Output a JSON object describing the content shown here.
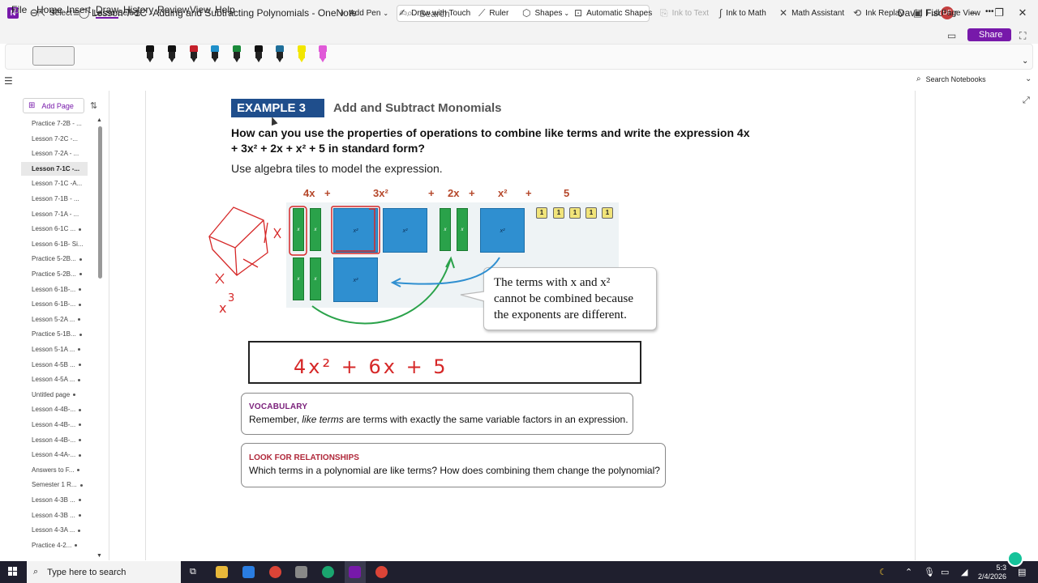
{
  "window": {
    "title": "Lesson 7-1C -Adding and Subtracting Polynomials - OneNote",
    "search_placeholder": "Search",
    "user_name": "David Fischer",
    "user_initials": "DF"
  },
  "menu": {
    "items": [
      "File",
      "Home",
      "Insert",
      "Draw",
      "History",
      "Review",
      "View",
      "Help"
    ],
    "active": "Draw",
    "share_label": "Share"
  },
  "ribbon": {
    "select": "Select",
    "lasso_select": "Lasso Select",
    "add_pen": "Add Pen",
    "draw_with_touch": "Draw with Touch",
    "ruler": "Ruler",
    "shapes": "Shapes",
    "automatic_shapes": "Automatic Shapes",
    "ink_to_text": "Ink to Text",
    "ink_to_shape": "Ink to Math",
    "math_assistant": "Math Assistant",
    "ink_replay": "Ink Replay",
    "full_page_view": "Full Page View",
    "more": "•••",
    "pen_colors": [
      "#111111",
      "#111111",
      "#c4202a",
      "#1f8fc9",
      "#1a8a3a",
      "#111111",
      "#1f6f9a",
      "#f2e600",
      "#e05ad8"
    ]
  },
  "search_notebooks": "Search Notebooks",
  "sidebar": {
    "add_page": "Add Page",
    "pages": [
      {
        "label": "Practice 7-2B - ...",
        "dot": false
      },
      {
        "label": "Lesson 7-2C -...",
        "dot": false
      },
      {
        "label": "Lesson 7-2A - ...",
        "dot": false
      },
      {
        "label": "Lesson 7-1C -...",
        "dot": false,
        "selected": true
      },
      {
        "label": "Lesson 7-1C -A...",
        "dot": false
      },
      {
        "label": "Lesson 7-1B - ...",
        "dot": false
      },
      {
        "label": "Lesson 7-1A - ...",
        "dot": false
      },
      {
        "label": "Lesson 6-1C ...",
        "dot": true
      },
      {
        "label": "Lesson 6-1B- Si...",
        "dot": false
      },
      {
        "label": "Practice 5-2B...",
        "dot": true
      },
      {
        "label": "Practice 5-2B...",
        "dot": true
      },
      {
        "label": "Lesson 6-1B-...",
        "dot": true
      },
      {
        "label": "Lesson 6-1B-...",
        "dot": true
      },
      {
        "label": "Lesson 5-2A ...",
        "dot": true
      },
      {
        "label": "Practice 5-1B...",
        "dot": true
      },
      {
        "label": "Lesson 5-1A ...",
        "dot": true
      },
      {
        "label": "Lesson 4-5B ...",
        "dot": true
      },
      {
        "label": "Lesson 4-5A ...",
        "dot": true
      },
      {
        "label": "Untitled page",
        "dot": true
      },
      {
        "label": "Lesson 4-4B-...",
        "dot": true
      },
      {
        "label": "Lesson 4-4B-...",
        "dot": true
      },
      {
        "label": "Lesson 4-4B-...",
        "dot": true
      },
      {
        "label": "Lesson 4-4A-...",
        "dot": true
      },
      {
        "label": "Answers to F...",
        "dot": true
      },
      {
        "label": "Semester 1 R...",
        "dot": true
      },
      {
        "label": "Lesson 4-3B ...",
        "dot": true
      },
      {
        "label": "Lesson 4-3B ...",
        "dot": true
      },
      {
        "label": "Lesson 4-3A ...",
        "dot": true
      },
      {
        "label": "Practice 4-2...",
        "dot": true
      }
    ]
  },
  "content": {
    "example_label": "EXAMPLE 3",
    "example_title": "Add and Subtract Monomials",
    "question_line1": "How can you use the properties of operations to combine like terms and write the expression 4x",
    "question_line2": "+ 3x² + 2x + x² + 5 in standard form?",
    "instruction": "Use algebra tiles to model the expression.",
    "tile_headers": [
      "4x",
      "+",
      "3x²",
      "+",
      "2x",
      "+",
      "x²",
      "+",
      "5"
    ],
    "tile_x_label": "x",
    "tile_x2_label": "x²",
    "tile_one_label": "1",
    "callout_line1": "The terms with x and x²",
    "callout_line2": "cannot be combined because",
    "callout_line3": "the exponents are different.",
    "answer_handwritten": "4x² + 6x + 5",
    "vocab_title": "VOCABULARY",
    "vocab_text_pre": "Remember, ",
    "vocab_text_em": "like terms",
    "vocab_text_post": " are terms with exactly the same variable factors in an expression.",
    "look_title": "LOOK FOR RELATIONSHIPS",
    "look_text": "Which terms in a polynomial are like terms? How does combining them change the polynomial?"
  },
  "taskbar": {
    "search_placeholder": "Type here to search",
    "time": "5:3",
    "date": "2/4/2026"
  }
}
